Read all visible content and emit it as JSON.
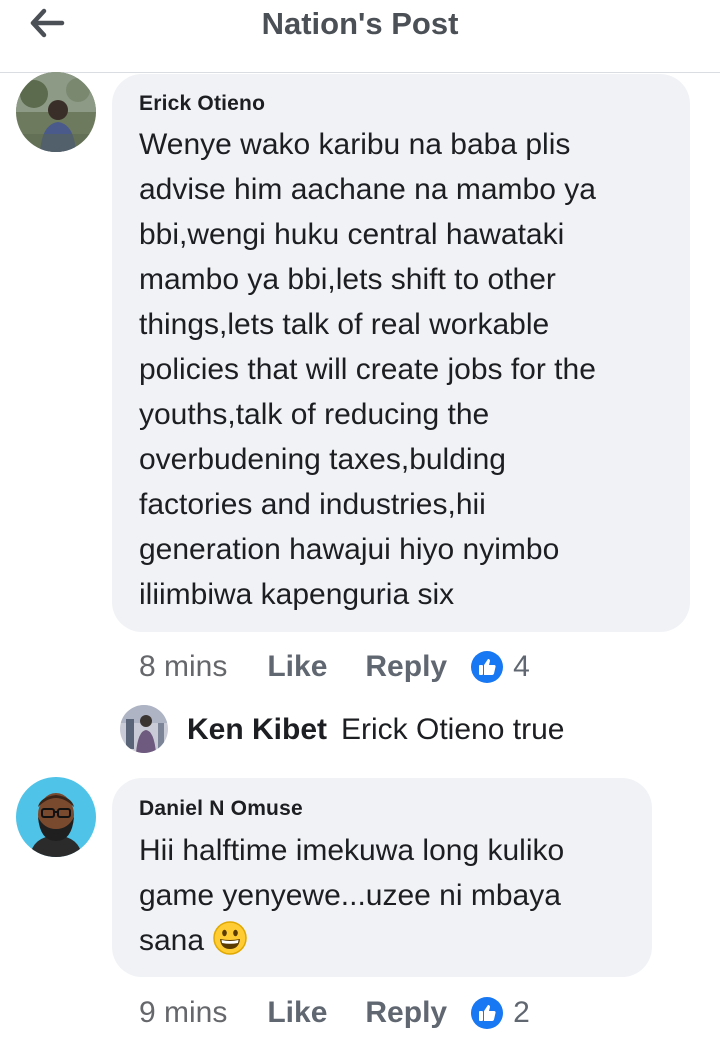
{
  "header": {
    "title": "Nation's Post",
    "back_icon": "arrow-left-icon"
  },
  "comments": [
    {
      "author": "Erick Otieno",
      "lines": [
        "Wenye wako karibu na baba plis",
        "advise him aachane na mambo ya",
        "bbi,wengi huku central hawataki",
        "mambo ya bbi,lets shift to other",
        "things,lets talk of real workable",
        "policies that will create jobs for the",
        "youths,talk of reducing the",
        "overbudening taxes,bulding",
        "factories and industries,hii",
        "generation hawajui hiyo nyimbo",
        "iliimbiwa kapenguria six"
      ],
      "time": "8 mins",
      "like_label": "Like",
      "reply_label": "Reply",
      "reaction_icon": "thumbs-up-icon",
      "reaction_count": "4",
      "reply": {
        "author": "Ken Kibet",
        "text": "Erick Otieno true"
      }
    },
    {
      "author": "Daniel N Omuse",
      "lines": [
        "Hii halftime imekuwa long kuliko",
        "game yenyewe...uzee ni mbaya",
        "sana"
      ],
      "emoji": "grinning-face-emoji",
      "time": "9 mins",
      "like_label": "Like",
      "reply_label": "Reply",
      "reaction_icon": "thumbs-up-icon",
      "reaction_count": "2"
    }
  ],
  "colors": {
    "bubble_bg": "#f0f2f5",
    "like_blue": "#1877f2",
    "meta_text": "#606770"
  }
}
